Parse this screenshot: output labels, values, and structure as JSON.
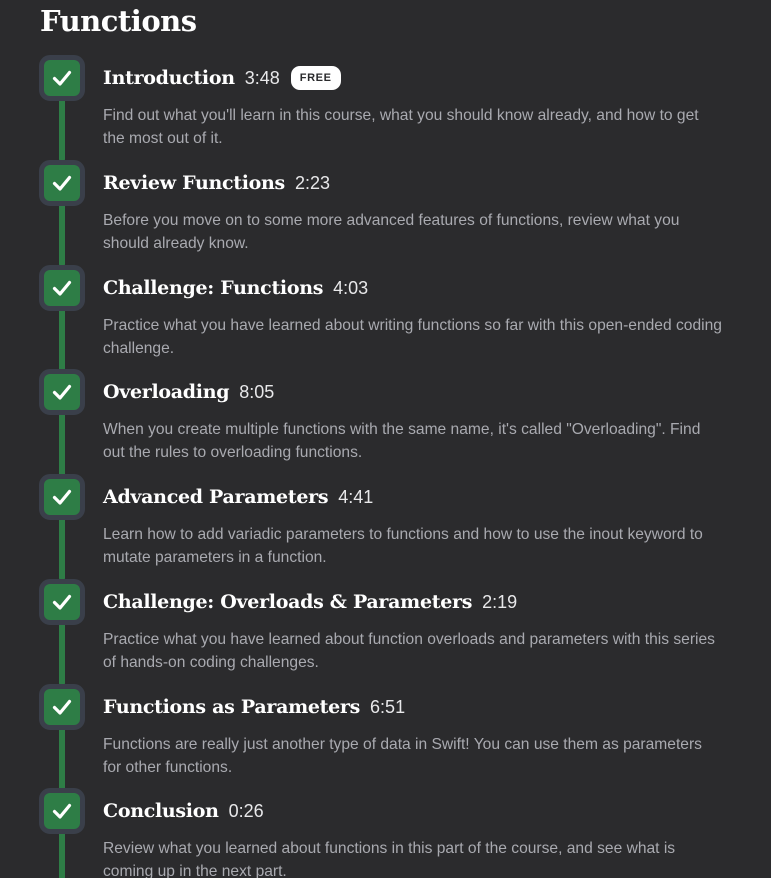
{
  "section": {
    "title": "Functions"
  },
  "colors": {
    "background": "#2b2b2d",
    "complete_green": "#2e7d46",
    "check_border": "#3a3f4a",
    "title_text": "#ffffff",
    "description_text": "#a9aab0"
  },
  "lessons": [
    {
      "title": "Introduction",
      "duration": "3:48",
      "badge": "FREE",
      "description": "Find out what you'll learn in this course, what you should know already, and how to get the most out of it.",
      "status_icon": "check-icon"
    },
    {
      "title": "Review Functions",
      "duration": "2:23",
      "description": "Before you move on to some more advanced features of functions, review what you should already know.",
      "status_icon": "check-icon"
    },
    {
      "title": "Challenge: Functions",
      "duration": "4:03",
      "description": "Practice what you have learned about writing functions so far with this open-ended coding challenge.",
      "status_icon": "check-icon"
    },
    {
      "title": "Overloading",
      "duration": "8:05",
      "description": "When you create multiple functions with the same name, it's called \"Overloading\". Find out the rules to overloading functions.",
      "status_icon": "check-icon"
    },
    {
      "title": "Advanced Parameters",
      "duration": "4:41",
      "description": "Learn how to add variadic parameters to functions and how to use the inout keyword to mutate parameters in a function.",
      "status_icon": "check-icon"
    },
    {
      "title": "Challenge: Overloads & Parameters",
      "duration": "2:19",
      "description": "Practice what you have learned about function overloads and parameters with this series of hands-on coding challenges.",
      "status_icon": "check-icon"
    },
    {
      "title": "Functions as Parameters",
      "duration": "6:51",
      "description": "Functions are really just another type of data in Swift! You can use them as parameters for other functions.",
      "status_icon": "check-icon"
    },
    {
      "title": "Conclusion",
      "duration": "0:26",
      "description": "Review what you learned about functions in this part of the course, and see what is coming up in the next part.",
      "status_icon": "check-icon"
    }
  ]
}
